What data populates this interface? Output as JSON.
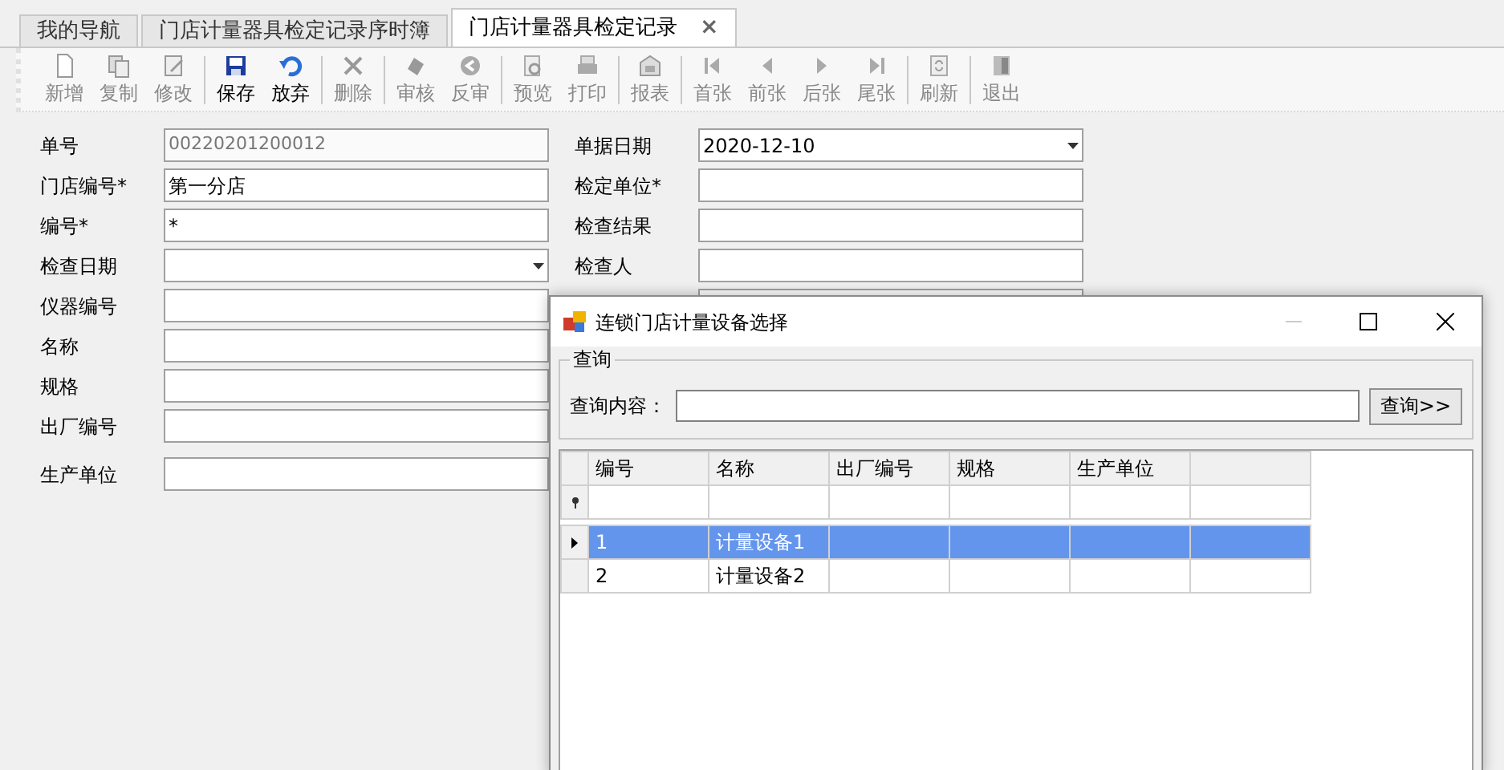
{
  "tabs": [
    {
      "label": "我的导航",
      "selected": false
    },
    {
      "label": "门店计量器具检定记录序时簿",
      "selected": false
    },
    {
      "label": "门店计量器具检定记录",
      "selected": true
    }
  ],
  "close_tab": "×",
  "toolbar": [
    {
      "kind": "button",
      "label": "新增",
      "disabled": true
    },
    {
      "kind": "button",
      "label": "复制",
      "disabled": true
    },
    {
      "kind": "button",
      "label": "修改",
      "disabled": true
    },
    {
      "kind": "separator"
    },
    {
      "kind": "button",
      "label": "保存",
      "disabled": false
    },
    {
      "kind": "button",
      "label": "放弃",
      "disabled": false
    },
    {
      "kind": "separator"
    },
    {
      "kind": "button",
      "label": "删除",
      "disabled": true
    },
    {
      "kind": "separator"
    },
    {
      "kind": "button",
      "label": "审核",
      "disabled": true
    },
    {
      "kind": "button",
      "label": "反审",
      "disabled": true
    },
    {
      "kind": "separator"
    },
    {
      "kind": "button",
      "label": "预览",
      "disabled": true
    },
    {
      "kind": "button",
      "label": "打印",
      "disabled": true
    },
    {
      "kind": "separator"
    },
    {
      "kind": "button",
      "label": "报表",
      "disabled": true
    },
    {
      "kind": "separator"
    },
    {
      "kind": "button",
      "label": "首张",
      "disabled": true
    },
    {
      "kind": "button",
      "label": "前张",
      "disabled": true
    },
    {
      "kind": "button",
      "label": "后张",
      "disabled": true
    },
    {
      "kind": "button",
      "label": "尾张",
      "disabled": true
    },
    {
      "kind": "separator"
    },
    {
      "kind": "button",
      "label": "刷新",
      "disabled": true
    },
    {
      "kind": "separator"
    },
    {
      "kind": "button",
      "label": "退出",
      "disabled": true
    }
  ],
  "left_fields": [
    {
      "label": "单号",
      "kind": "readonly",
      "value": "00220201200012"
    },
    {
      "label": "门店编号*",
      "kind": "text",
      "value": "第一分店"
    },
    {
      "label": "编号*",
      "kind": "text",
      "value": "*"
    },
    {
      "label": "检查日期",
      "kind": "dropdown"
    },
    {
      "label": "仪器编号",
      "kind": "text"
    },
    {
      "label": "名称",
      "kind": "text"
    },
    {
      "label": "规格",
      "kind": "text"
    },
    {
      "label": "出厂编号",
      "kind": "text"
    },
    {
      "label": "生产单位",
      "kind": "text"
    }
  ],
  "right_fields": [
    {
      "label": "单据日期",
      "kind": "dropdown",
      "value": "2020-12-10"
    },
    {
      "label": "检定单位*",
      "kind": "text"
    },
    {
      "label": "检查结果",
      "kind": "text"
    },
    {
      "label": "检查人",
      "kind": "text"
    },
    {
      "kind": "text"
    }
  ],
  "dialog": {
    "title": "连锁门店计量设备选择",
    "group_title": "查询",
    "query_label": "查询内容：",
    "query_button": "查询>>",
    "columns": [
      "编号",
      "名称",
      "出厂编号",
      "规格",
      "生产单位"
    ],
    "rows": [
      {
        "cells": [
          "1",
          "计量设备1"
        ],
        "selected": true
      },
      {
        "cells": [
          "2",
          "计量设备2"
        ],
        "selected": false
      }
    ]
  }
}
